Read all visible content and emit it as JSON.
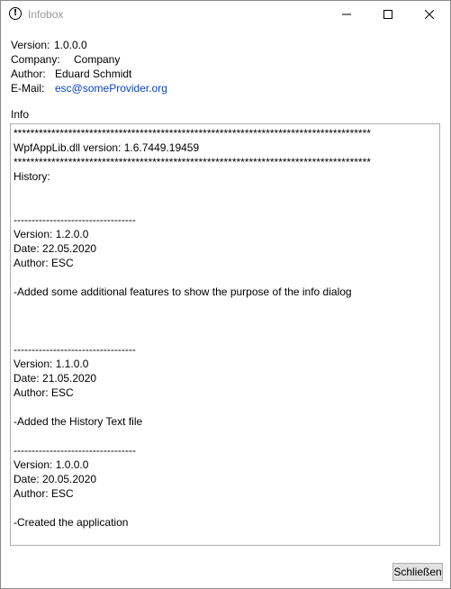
{
  "window": {
    "title": "Infobox",
    "controls": {
      "minimize_icon": "minimize-icon",
      "maximize_icon": "maximize-icon",
      "close_icon": "close-icon"
    }
  },
  "info": {
    "version_label": "Version:",
    "version_value": "1.0.0.0",
    "company_label": "Company:",
    "company_value": "Company",
    "author_label": "Author:",
    "author_value": "Eduard Schmidt",
    "email_label": "E-Mail:",
    "email_value": "esc@someProvider.org"
  },
  "section_label": "Info",
  "textbox_lines": [
    "*************************************************************************************",
    "WpfAppLib.dll version: 1.6.7449.19459",
    "*************************************************************************************",
    "History:",
    "",
    "",
    "----------------------------------",
    "Version: 1.2.0.0",
    "Date: 22.05.2020",
    "Author: ESC",
    "",
    "-Added some additional features to show the purpose of the info dialog",
    "",
    "",
    "",
    "----------------------------------",
    "Version: 1.1.0.0",
    "Date: 21.05.2020",
    "Author: ESC",
    "",
    "-Added the History Text file",
    "",
    "----------------------------------",
    "Version: 1.0.0.0",
    "Date: 20.05.2020",
    "Author: ESC",
    "",
    "-Created the application"
  ],
  "buttons": {
    "close_label": "Schließen"
  },
  "colors": {
    "link": "#0645d1",
    "title_text": "#999999",
    "button_bg": "#e1e1e1"
  }
}
